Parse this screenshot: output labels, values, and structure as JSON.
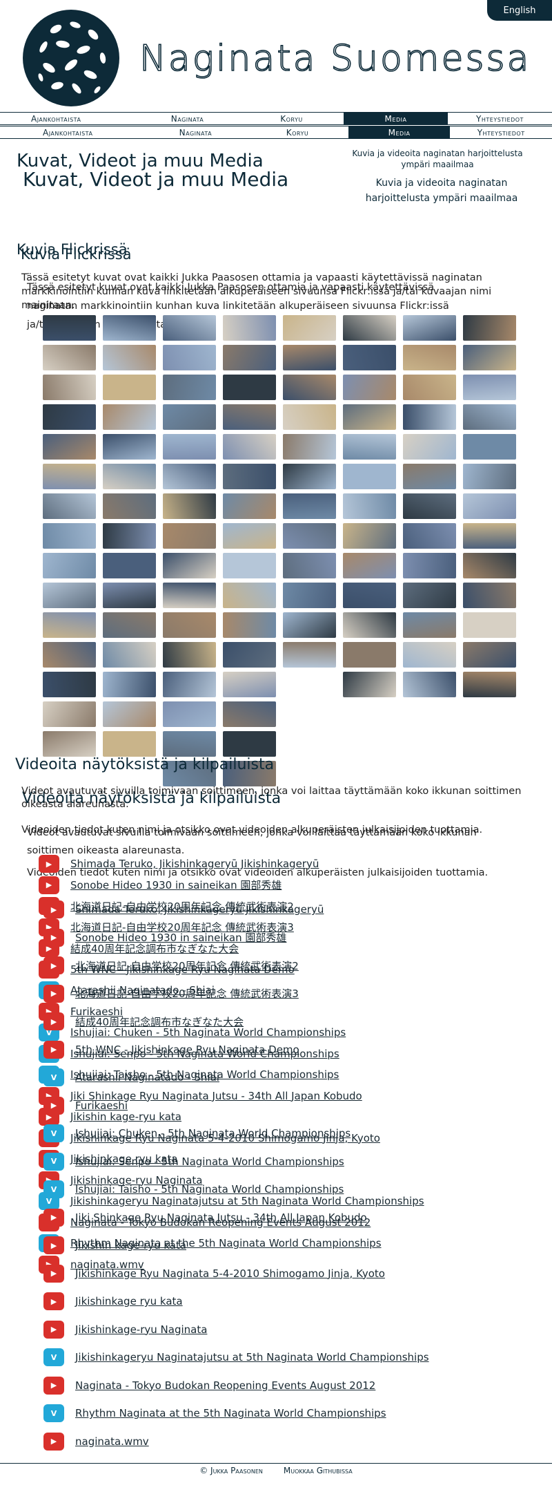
{
  "language_button": "English",
  "site_title": "Naginata Suomessa",
  "nav": [
    "Ajankohtaista",
    "Naginata",
    "Koryu",
    "Media",
    "Yhteystiedot"
  ],
  "nav_active": "Media",
  "page_title": "Kuvat, Videot ja muu Media",
  "page_subtitle": "Kuvia ja videoita naginatan harjoittelusta ympäri maailmaa",
  "flickr": {
    "heading": "Kuvia Flickrissä",
    "text": "Tässä esitetyt kuvat ovat kaikki Jukka Paasosen ottamia ja vapaasti käytettävissä naginatan markkinointiin kunhan kuva linkitetään alkuperäiseen sivuunsa Flickr:issä ja/tai kuvaajan nimi mainitaan."
  },
  "videos": {
    "heading": "Videoita näytöksistä ja kilpailuista",
    "text1": "Videot avautuvat sivuilla toimivaan soittimeen, jonka voi laittaa täyttämään koko ikkunan soittimen oikeasta alareunasta.",
    "text2": "Videoiden tiedot kuten nimi ja otsikko ovat videoiden alkuperäisten julkaisijoiden tuottamia.",
    "items": [
      {
        "title": "Shimada Teruko, Jikishinkageryū Jikishinkageryū",
        "src": "youtube"
      },
      {
        "title": "Sonobe Hideo 1930 in saineikan 園部秀雄",
        "src": "youtube"
      },
      {
        "title": "北海道日記-自由学校20周年記念 傳統武術表演2",
        "src": "youtube"
      },
      {
        "title": "北海道日記-自由学校20周年記念 傳統武術表演3",
        "src": "youtube"
      },
      {
        "title": "結成40周年記念調布市なぎなた大会",
        "src": "youtube"
      },
      {
        "title": "5th WNC - Jikishinkage Ryu Naginata Demo",
        "src": "youtube"
      },
      {
        "title": "Atarashii Naginatado - Shiai",
        "src": "vimeo"
      },
      {
        "title": "Furikaeshi",
        "src": "youtube"
      },
      {
        "title": "Ishujiai: Chuken - 5th Naginata World Championships",
        "src": "vimeo"
      },
      {
        "title": "Ishujiai: Senpo - 5th Naginata World Championships",
        "src": "vimeo"
      },
      {
        "title": "Ishujiai: Taisho - 5th Naginata World Championships",
        "src": "vimeo"
      },
      {
        "title": "Jiki Shinkage Ryu Naginata Jutsu - 34th All Japan Kobudo",
        "src": "youtube"
      },
      {
        "title": "Jikishin kage-ryu kata",
        "src": "youtube"
      },
      {
        "title": "Jikishinkage Ryu Naginata 5-4-2010 Shimogamo Jinja, Kyoto",
        "src": "youtube"
      },
      {
        "title": "Jikishinkage ryu kata",
        "src": "youtube"
      },
      {
        "title": "Jikishinkage-ryu Naginata",
        "src": "youtube"
      },
      {
        "title": "Jikishinkageryu Naginatajutsu at 5th Naginata World Championships",
        "src": "vimeo"
      },
      {
        "title": "Naginata - Tokyo Budokan Reopening Events August 2012",
        "src": "youtube"
      },
      {
        "title": "Rhythm Naginata at the 5th Naginata World Championships",
        "src": "vimeo"
      },
      {
        "title": "naginata.wmv",
        "src": "youtube"
      }
    ]
  },
  "footer": {
    "copyright": "© Jukka Paasonen",
    "edit_link": "Muokkaa Githubissa"
  }
}
